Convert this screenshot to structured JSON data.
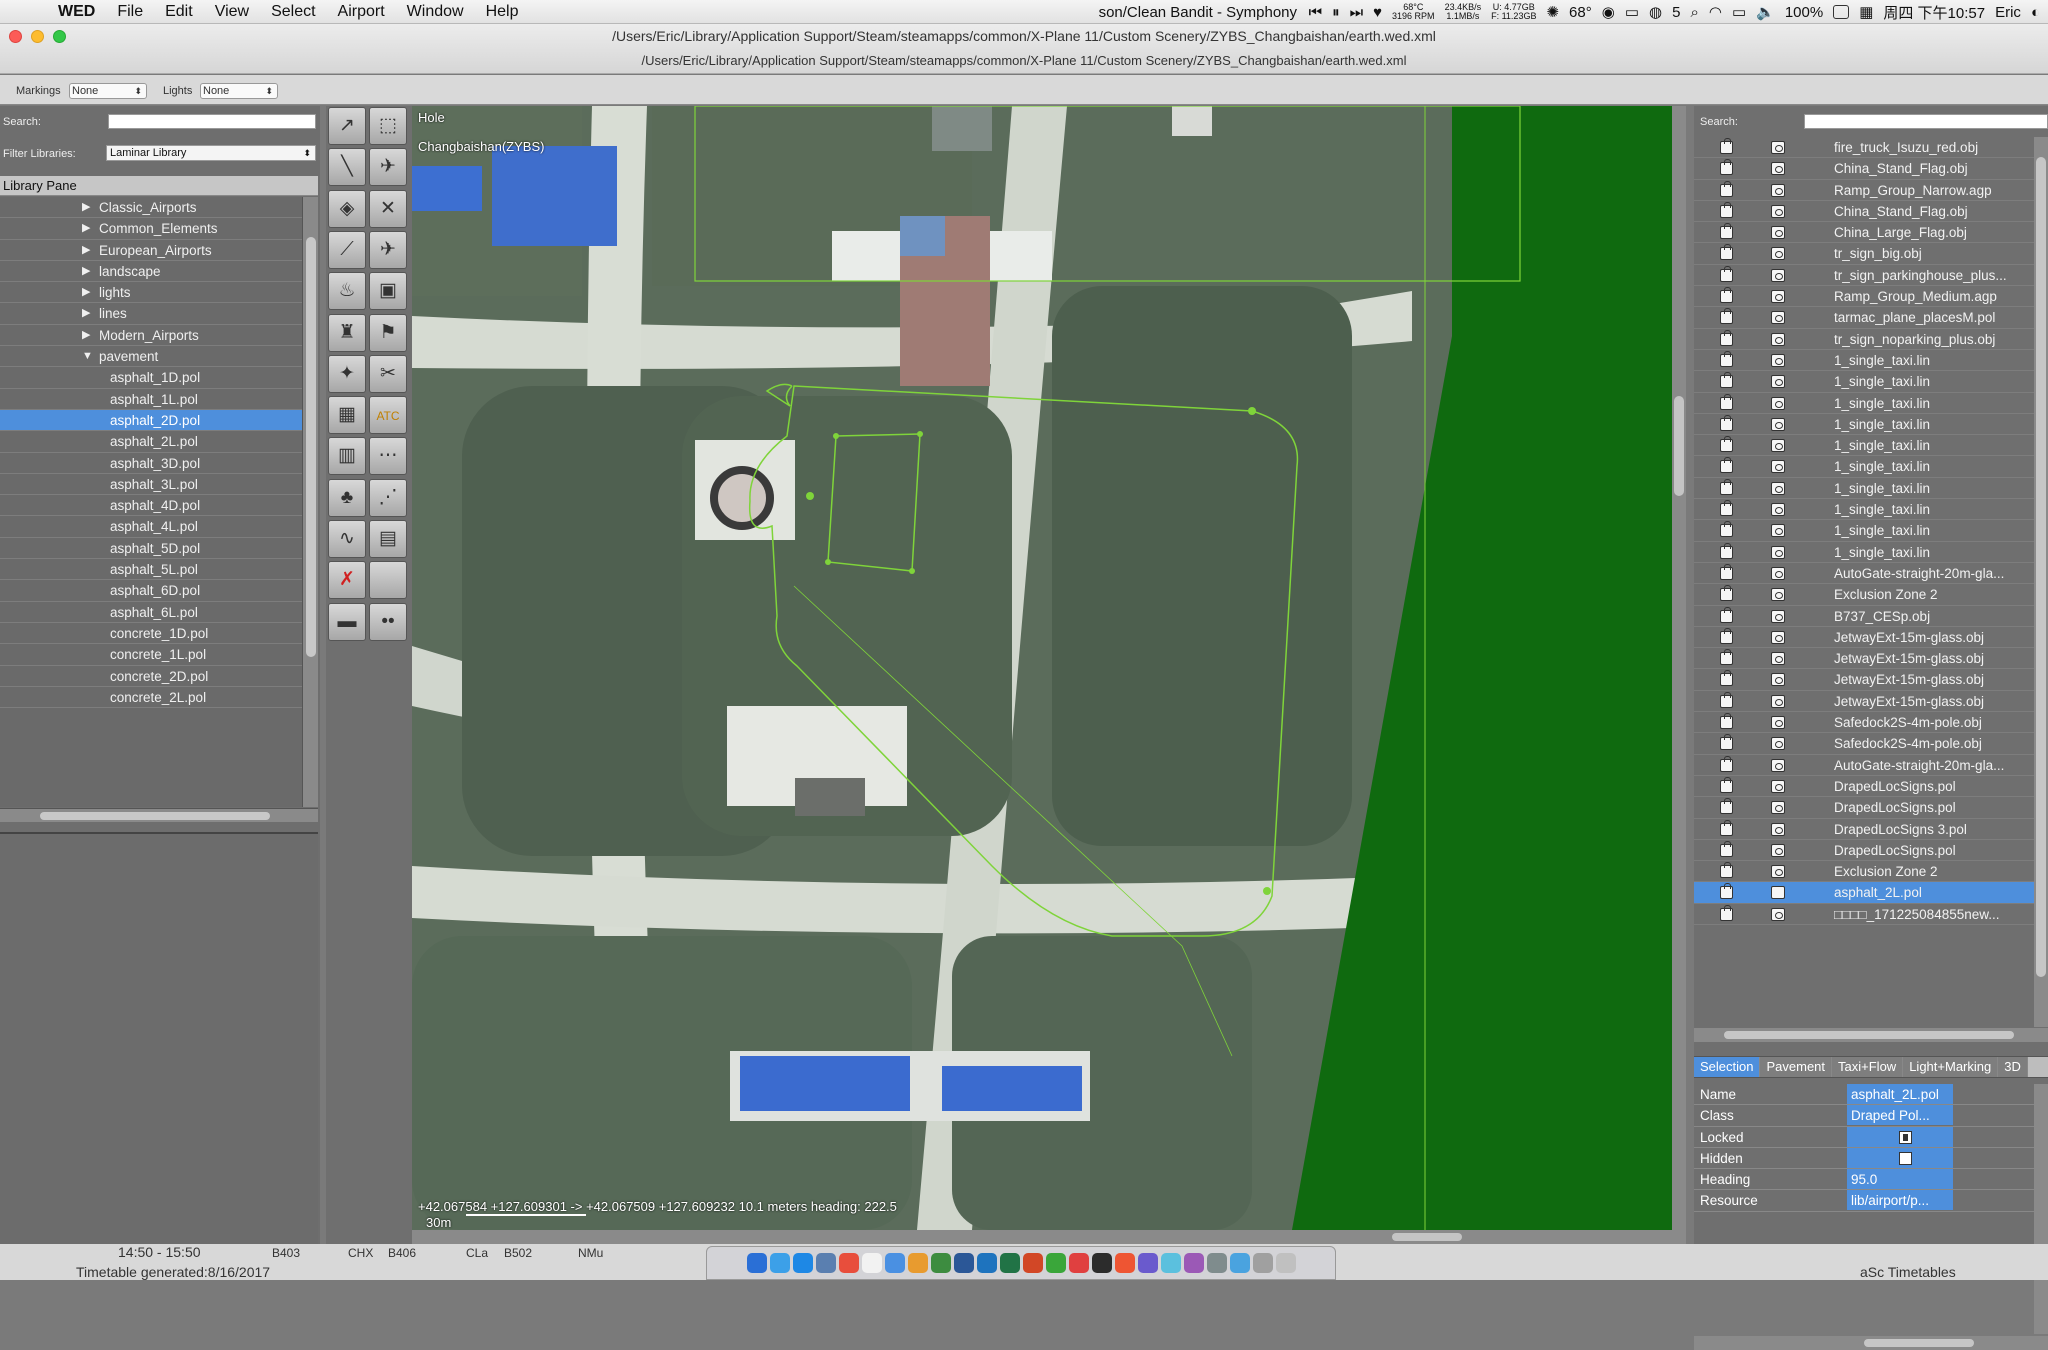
{
  "menubar": {
    "app": "WED",
    "menus": [
      "File",
      "Edit",
      "View",
      "Select",
      "Airport",
      "Window",
      "Help"
    ],
    "now_playing": "son/Clean Bandit - Symphony",
    "cpu_temp": "68°C",
    "fan": "3196 RPM",
    "net_up": "23.4KB/s",
    "net_down": "1.1MB/s",
    "disk_u": "U: 4.77GB",
    "disk_f": "F: 11.23GB",
    "weather": "68°",
    "wechat_count": "5",
    "battery": "100%",
    "datetime": "周四 下午10:57",
    "user": "Eric"
  },
  "window": {
    "title": "/Users/Eric/Library/Application Support/Steam/steamapps/common/X-Plane 11/Custom Scenery/ZYBS_Changbaishan/earth.wed.xml",
    "subtitle": "/Users/Eric/Library/Application Support/Steam/steamapps/common/X-Plane 11/Custom Scenery/ZYBS_Changbaishan/earth.wed.xml"
  },
  "toolbar": {
    "markings_label": "Markings",
    "markings_value": "None",
    "lights_label": "Lights",
    "lights_value": "None"
  },
  "library": {
    "search_label": "Search:",
    "filter_label": "Filter Libraries:",
    "filter_value": "Laminar Library",
    "header": "Library Pane",
    "items": [
      {
        "label": "Classic_Airports",
        "type": "folder"
      },
      {
        "label": "Common_Elements",
        "type": "folder"
      },
      {
        "label": "European_Airports",
        "type": "folder"
      },
      {
        "label": "landscape",
        "type": "folder"
      },
      {
        "label": "lights",
        "type": "folder"
      },
      {
        "label": "lines",
        "type": "folder"
      },
      {
        "label": "Modern_Airports",
        "type": "folder"
      },
      {
        "label": "pavement",
        "type": "open"
      },
      {
        "label": "asphalt_1D.pol",
        "type": "file"
      },
      {
        "label": "asphalt_1L.pol",
        "type": "file"
      },
      {
        "label": "asphalt_2D.pol",
        "type": "file",
        "selected": true
      },
      {
        "label": "asphalt_2L.pol",
        "type": "file"
      },
      {
        "label": "asphalt_3D.pol",
        "type": "file"
      },
      {
        "label": "asphalt_3L.pol",
        "type": "file"
      },
      {
        "label": "asphalt_4D.pol",
        "type": "file"
      },
      {
        "label": "asphalt_4L.pol",
        "type": "file"
      },
      {
        "label": "asphalt_5D.pol",
        "type": "file"
      },
      {
        "label": "asphalt_5L.pol",
        "type": "file"
      },
      {
        "label": "asphalt_6D.pol",
        "type": "file"
      },
      {
        "label": "asphalt_6L.pol",
        "type": "file"
      },
      {
        "label": "concrete_1D.pol",
        "type": "file"
      },
      {
        "label": "concrete_1L.pol",
        "type": "file"
      },
      {
        "label": "concrete_2D.pol",
        "type": "file"
      },
      {
        "label": "concrete_2L.pol",
        "type": "file"
      }
    ]
  },
  "tools": [
    {
      "name": "vertex-tool",
      "icon": "↗"
    },
    {
      "name": "marquee-tool",
      "icon": "⬚"
    },
    {
      "name": "runway-tool",
      "icon": "╲"
    },
    {
      "name": "sealane-tool",
      "icon": "✈"
    },
    {
      "name": "helipad-tool",
      "icon": "◈"
    },
    {
      "name": "taxiway-tool",
      "icon": "✕"
    },
    {
      "name": "taxiline-tool",
      "icon": "⟋"
    },
    {
      "name": "ramp-start-tool",
      "icon": "✈"
    },
    {
      "name": "light-fixture-tool",
      "icon": "♨"
    },
    {
      "name": "sign-tool",
      "icon": "▣"
    },
    {
      "name": "tower-viewpoint-tool",
      "icon": "♜"
    },
    {
      "name": "windsock-tool",
      "icon": "⚑"
    },
    {
      "name": "beacon-tool",
      "icon": "✦"
    },
    {
      "name": "boundary-tool",
      "icon": "✂"
    },
    {
      "name": "forest-tool",
      "icon": "▦"
    },
    {
      "name": "atc-frequency-tool",
      "icon": "ATC"
    },
    {
      "name": "facade-tool",
      "icon": "▥"
    },
    {
      "name": "string-tool",
      "icon": "⋯"
    },
    {
      "name": "object-tool",
      "icon": "♣"
    },
    {
      "name": "line-tool",
      "icon": "⋰"
    },
    {
      "name": "polygon-tool",
      "icon": "∿"
    },
    {
      "name": "draped-polygon-tool",
      "icon": "▤"
    },
    {
      "name": "exclusion-tool",
      "icon": "✗"
    },
    {
      "name": "blank-tool",
      "icon": ""
    },
    {
      "name": "truck-parking-tool",
      "icon": "▬"
    },
    {
      "name": "truck-destination-tool",
      "icon": "••"
    }
  ],
  "map": {
    "layer_label": "Hole",
    "airport_label": "Changbaishan(ZYBS)",
    "coords": "+42.067584 +127.609301 -> +42.067509 +127.609232 10.1 meters heading: 222.5",
    "scale": "30m"
  },
  "hierarchy": {
    "search_label": "Search:",
    "items": [
      "fire_truck_Isuzu_red.obj",
      "China_Stand_Flag.obj",
      "Ramp_Group_Narrow.agp",
      "China_Stand_Flag.obj",
      "China_Large_Flag.obj",
      "tr_sign_big.obj",
      "tr_sign_parkinghouse_plus...",
      "Ramp_Group_Medium.agp",
      "tarmac_plane_placesM.pol",
      "tr_sign_noparking_plus.obj",
      "1_single_taxi.lin",
      "1_single_taxi.lin",
      "1_single_taxi.lin",
      "1_single_taxi.lin",
      "1_single_taxi.lin",
      "1_single_taxi.lin",
      "1_single_taxi.lin",
      "1_single_taxi.lin",
      "1_single_taxi.lin",
      "1_single_taxi.lin",
      "AutoGate-straight-20m-gla...",
      "Exclusion Zone 2",
      "B737_CESp.obj",
      "JetwayExt-15m-glass.obj",
      "JetwayExt-15m-glass.obj",
      "JetwayExt-15m-glass.obj",
      "JetwayExt-15m-glass.obj",
      "Safedock2S-4m-pole.obj",
      "Safedock2S-4m-pole.obj",
      "AutoGate-straight-20m-gla...",
      "DrapedLocSigns.pol",
      "DrapedLocSigns.pol",
      "DrapedLocSigns 3.pol",
      "DrapedLocSigns.pol",
      "Exclusion Zone 2",
      "asphalt_2L.pol",
      "□□□□_171225084855new..."
    ],
    "selected_index": 35
  },
  "tabs": [
    "Selection",
    "Pavement",
    "Taxi+Flow",
    "Light+Marking",
    "3D"
  ],
  "properties": [
    {
      "key": "Name",
      "value": "asphalt_2L.pol"
    },
    {
      "key": "Class",
      "value": "Draped Pol..."
    },
    {
      "key": "Locked",
      "value": "",
      "checkbox": "locked"
    },
    {
      "key": "Hidden",
      "value": "",
      "checkbox": "empty"
    },
    {
      "key": "Heading",
      "value": "95.0"
    },
    {
      "key": "Resource",
      "value": "lib/airport/p..."
    }
  ],
  "background_window": {
    "time_range": "14:50 - 15:50",
    "col1": "B403",
    "col2": "CHX",
    "col3": "B406",
    "col4": "CLa",
    "col5": "B502",
    "col6": "NMu",
    "footer": "Timetable generated:8/16/2017",
    "app": "aSc Timetables"
  },
  "colors": {
    "selection": "#4e8fdc",
    "mask_green": "#0f6a0f",
    "guide_green": "#7fd43a"
  }
}
